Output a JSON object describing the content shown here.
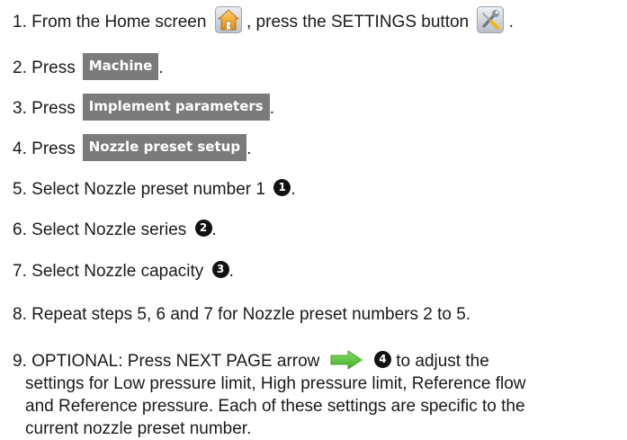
{
  "steps": [
    {
      "number": "1.",
      "text_before": "From the Home screen",
      "text_mid": ", press the SETTINGS button",
      "text_after": ".",
      "icons": [
        "home-icon",
        "settings-tools-icon"
      ]
    },
    {
      "number": "2.",
      "text": "Press",
      "button_label": "Machine",
      "text_after": "."
    },
    {
      "number": "3.",
      "text": "Press",
      "button_label": "Implement parameters",
      "text_after": "."
    },
    {
      "number": "4.",
      "text": "Press",
      "button_label": "Nozzle preset setup",
      "text_after": "."
    },
    {
      "number": "5.",
      "text": "Select Nozzle preset number 1",
      "callout": "1",
      "text_after": "."
    },
    {
      "number": "6.",
      "text": "Select Nozzle series",
      "callout": "2",
      "text_after": "."
    },
    {
      "number": "7.",
      "text": "Select Nozzle capacity",
      "callout": "3",
      "text_after": "."
    },
    {
      "number": "8.",
      "text": "Repeat steps 5, 6 and 7 for Nozzle preset numbers 2 to 5."
    },
    {
      "number": "9.",
      "text_before": "OPTIONAL: Press NEXT PAGE arrow",
      "callout": "4",
      "line1_after": "to adjust the",
      "line2": "settings for Low pressure limit, High pressure limit, Reference flow",
      "line3": "and Reference pressure. Each of these settings are specific to the",
      "line4": "current nozzle preset number.",
      "icon": "next-page-arrow-icon"
    }
  ],
  "colors": {
    "button_bg": "#7b7b7b",
    "button_text": "#ffffff",
    "callout_bg": "#111111",
    "arrow_green": "#5cc83a",
    "home_orange": "#f0a02a"
  }
}
